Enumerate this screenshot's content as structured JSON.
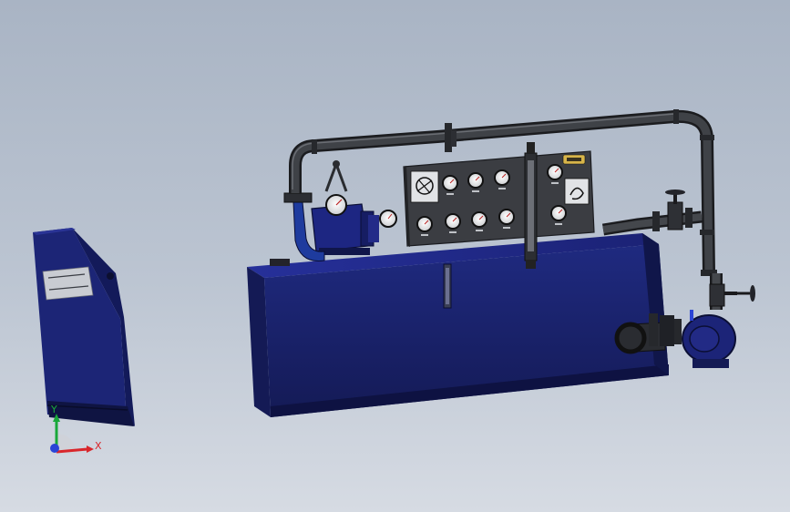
{
  "viewport": {
    "background_top": "#a9b4c4",
    "background_bottom": "#d6dbe3"
  },
  "model": {
    "tank_color": "#1c2470",
    "pipe_color": "#2f3136",
    "panel_color": "#3a3c40",
    "cabinet_nameplate": {
      "line1": "",
      "line2": ""
    }
  },
  "triad": {
    "y_label": "Y",
    "x_label": "X",
    "y_color": "#19a83a",
    "x_color": "#d9262b",
    "z_color": "#2b44d6"
  }
}
